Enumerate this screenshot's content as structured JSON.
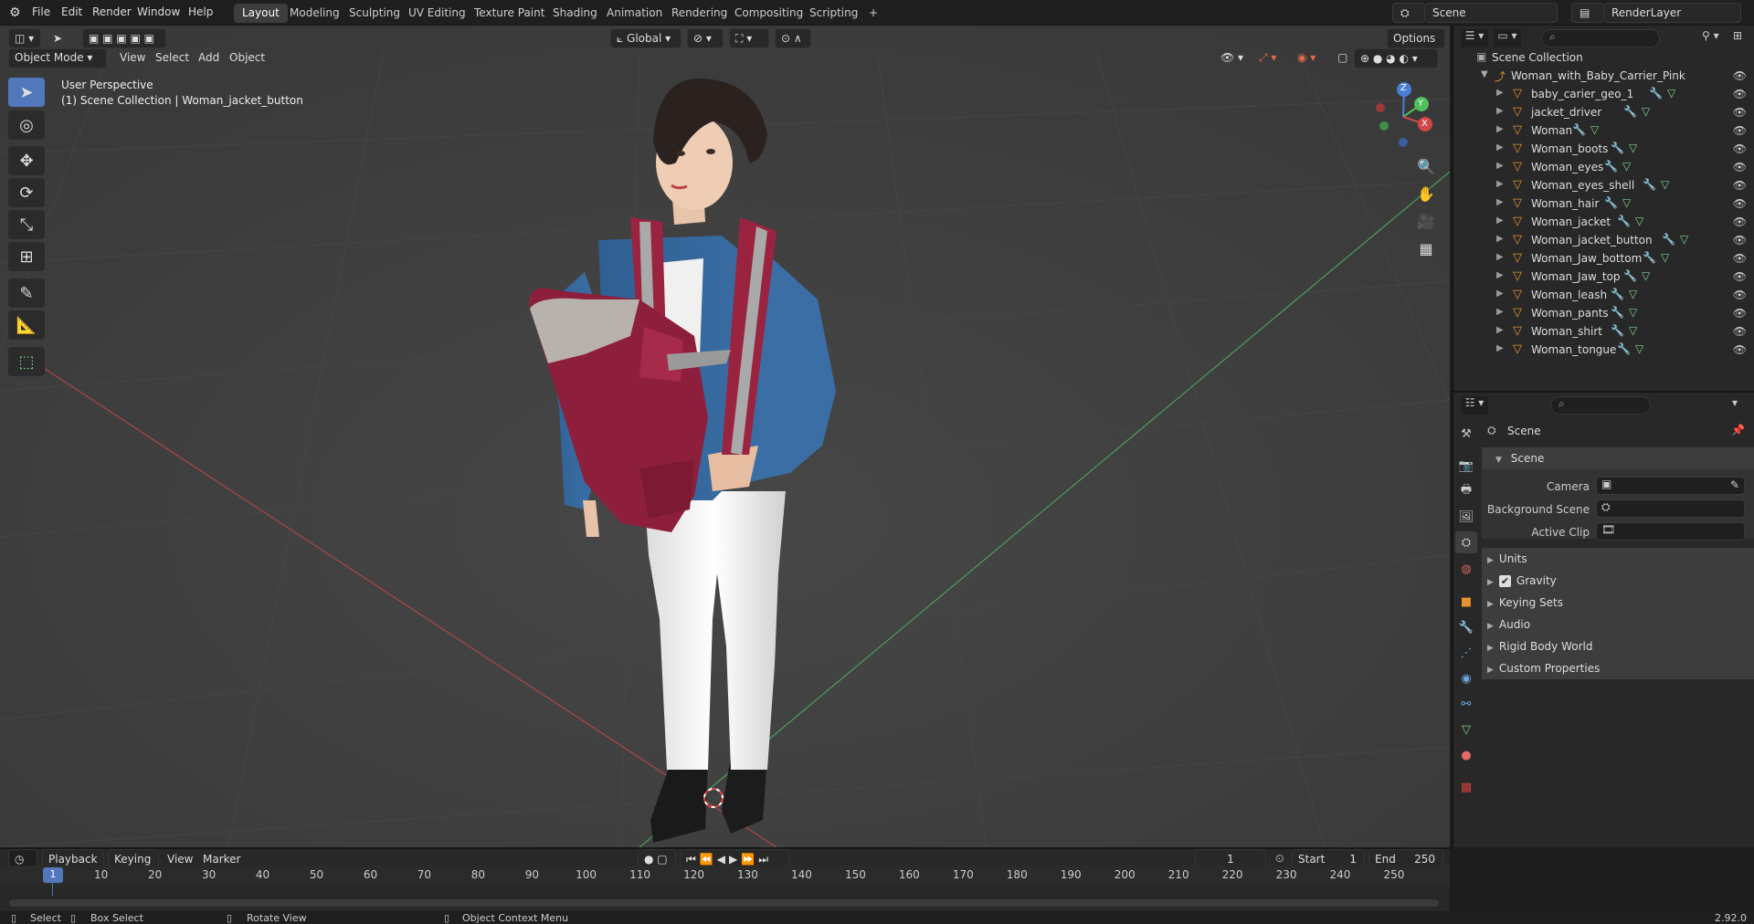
{
  "topbar": {
    "menus": [
      "File",
      "Edit",
      "Render",
      "Window",
      "Help"
    ],
    "workspaces": [
      "Layout",
      "Modeling",
      "Sculpting",
      "UV Editing",
      "Texture Paint",
      "Shading",
      "Animation",
      "Rendering",
      "Compositing",
      "Scripting"
    ],
    "active_workspace": "Layout",
    "add_tab": "+",
    "scene": "Scene",
    "render_layer": "RenderLayer"
  },
  "viewport_header": {
    "mode": "Object Mode",
    "menus": [
      "View",
      "Select",
      "Add",
      "Object"
    ],
    "orientation": "Global",
    "options": "Options"
  },
  "viewport": {
    "perspective": "User Perspective",
    "context": "(1) Scene Collection | Woman_jacket_button",
    "gizmo": {
      "x": "X",
      "y": "Y",
      "z": "Z"
    }
  },
  "outliner": {
    "root": "Scene Collection",
    "collection": "Woman_with_Baby_Carrier_Pink",
    "items": [
      "baby_carier_geo_1",
      "jacket_driver",
      "Woman",
      "Woman_boots",
      "Woman_eyes",
      "Woman_eyes_shell",
      "Woman_hair",
      "Woman_jacket",
      "Woman_jacket_button",
      "Woman_Jaw_bottom",
      "Woman_Jaw_top",
      "Woman_leash",
      "Woman_pants",
      "Woman_shirt",
      "Woman_tongue"
    ]
  },
  "properties": {
    "context_title": "Scene",
    "panel": "Scene",
    "fields": {
      "camera": "Camera",
      "background_scene": "Background Scene",
      "active_clip": "Active Clip"
    },
    "subpanels": [
      "Units",
      "Gravity",
      "Keying Sets",
      "Audio",
      "Rigid Body World",
      "Custom Properties"
    ],
    "gravity_checked": true
  },
  "timeline": {
    "menus": [
      "Playback",
      "Keying",
      "View",
      "Marker"
    ],
    "current_frame": "1",
    "start_label": "Start",
    "start": "1",
    "end_label": "End",
    "end": "250",
    "ticks": [
      "1",
      "10",
      "20",
      "30",
      "40",
      "50",
      "60",
      "70",
      "80",
      "90",
      "100",
      "110",
      "120",
      "130",
      "140",
      "150",
      "160",
      "170",
      "180",
      "190",
      "200",
      "210",
      "220",
      "230",
      "240",
      "250"
    ]
  },
  "statusbar": {
    "select": "Select",
    "box_select": "Box Select",
    "rotate_view": "Rotate View",
    "context_menu": "Object Context Menu",
    "version": "2.92.0"
  },
  "colors": {
    "accent": "#5078ba",
    "object_orange": "#e8912e",
    "axis_red": "#d14747",
    "axis_green": "#4fbf5b",
    "axis_blue": "#4b7fd6"
  }
}
